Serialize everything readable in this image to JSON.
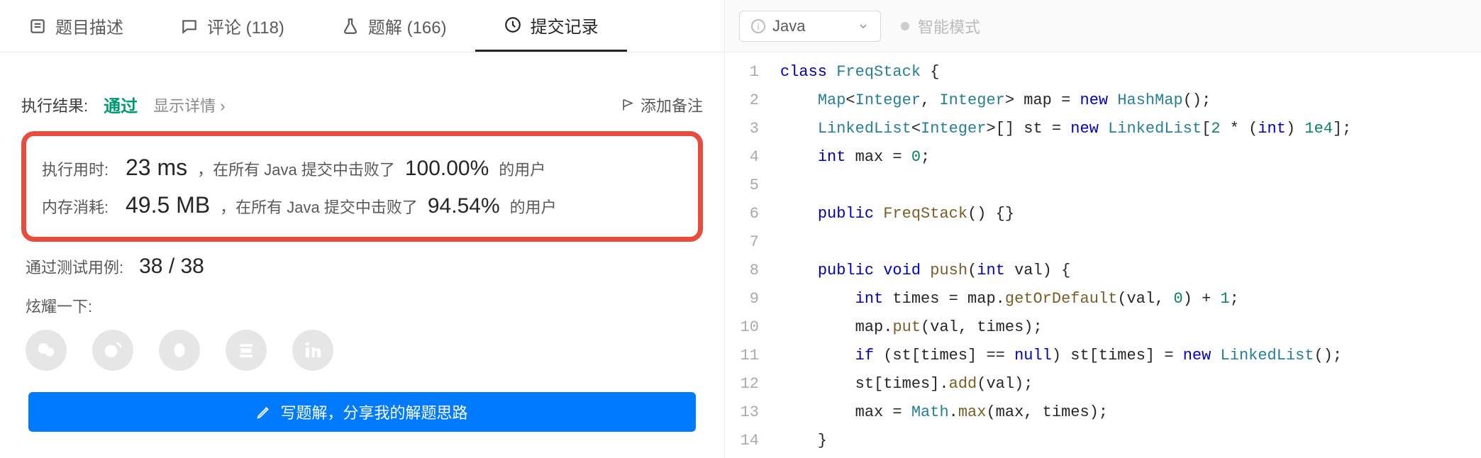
{
  "tabs": {
    "description": "题目描述",
    "comments": "评论 (118)",
    "solutions": "题解 (166)",
    "submissions": "提交记录"
  },
  "result": {
    "resultLabel": "执行结果:",
    "status": "通过",
    "detail": "显示详情 ›",
    "addNote": "添加备注",
    "runtime": {
      "label": "执行用时:",
      "value": "23 ms",
      "middle": "，在所有 Java 提交中击败了",
      "percent": "100.00%",
      "suffix": "的用户"
    },
    "memory": {
      "label": "内存消耗:",
      "value": "49.5 MB",
      "middle": "，在所有 Java 提交中击败了",
      "percent": "94.54%",
      "suffix": "的用户"
    },
    "cases": {
      "label": "通过测试用例:",
      "value": "38 / 38"
    },
    "share": {
      "label": "炫耀一下:"
    },
    "writeButton": "写题解，分享我的解题思路"
  },
  "editor": {
    "language": "Java",
    "smartMode": "智能模式",
    "code": [
      {
        "n": 1,
        "tokens": [
          [
            "kw",
            "class"
          ],
          [
            "",
            " "
          ],
          [
            "typ",
            "FreqStack"
          ],
          [
            "",
            " {"
          ]
        ]
      },
      {
        "n": 2,
        "tokens": [
          [
            "",
            "    "
          ],
          [
            "typ",
            "Map"
          ],
          [
            "",
            "<"
          ],
          [
            "typ",
            "Integer"
          ],
          [
            "",
            ", "
          ],
          [
            "typ",
            "Integer"
          ],
          [
            "",
            "> "
          ],
          [
            "",
            "map = "
          ],
          [
            "kw",
            "new"
          ],
          [
            "",
            " "
          ],
          [
            "typ",
            "HashMap"
          ],
          [
            "",
            "();"
          ]
        ]
      },
      {
        "n": 3,
        "tokens": [
          [
            "",
            "    "
          ],
          [
            "typ",
            "LinkedList"
          ],
          [
            "",
            "<"
          ],
          [
            "typ",
            "Integer"
          ],
          [
            "",
            ">[] st = "
          ],
          [
            "kw",
            "new"
          ],
          [
            "",
            " "
          ],
          [
            "typ",
            "LinkedList"
          ],
          [
            "",
            "["
          ],
          [
            "num",
            "2"
          ],
          [
            "",
            " * ("
          ],
          [
            "kw",
            "int"
          ],
          [
            "",
            ") "
          ],
          [
            "num",
            "1e4"
          ],
          [
            "",
            "];"
          ]
        ]
      },
      {
        "n": 4,
        "tokens": [
          [
            "",
            "    "
          ],
          [
            "kw",
            "int"
          ],
          [
            "",
            " max = "
          ],
          [
            "num",
            "0"
          ],
          [
            "",
            ";"
          ]
        ]
      },
      {
        "n": 5,
        "tokens": [
          [
            "",
            ""
          ]
        ]
      },
      {
        "n": 6,
        "tokens": [
          [
            "",
            "    "
          ],
          [
            "kw",
            "public"
          ],
          [
            "",
            " "
          ],
          [
            "mname",
            "FreqStack"
          ],
          [
            "",
            "() {}"
          ]
        ]
      },
      {
        "n": 7,
        "tokens": [
          [
            "",
            ""
          ]
        ]
      },
      {
        "n": 8,
        "tokens": [
          [
            "",
            "    "
          ],
          [
            "kw",
            "public"
          ],
          [
            "",
            " "
          ],
          [
            "kw",
            "void"
          ],
          [
            "",
            " "
          ],
          [
            "mname",
            "push"
          ],
          [
            "",
            "("
          ],
          [
            "kw",
            "int"
          ],
          [
            "",
            " val) {"
          ]
        ]
      },
      {
        "n": 9,
        "tokens": [
          [
            "",
            "        "
          ],
          [
            "kw",
            "int"
          ],
          [
            "",
            " times = map."
          ],
          [
            "mname",
            "getOrDefault"
          ],
          [
            "",
            "(val, "
          ],
          [
            "num",
            "0"
          ],
          [
            "",
            ") + "
          ],
          [
            "num",
            "1"
          ],
          [
            "",
            ";"
          ]
        ]
      },
      {
        "n": 10,
        "tokens": [
          [
            "",
            "        map."
          ],
          [
            "mname",
            "put"
          ],
          [
            "",
            "(val, times);"
          ]
        ]
      },
      {
        "n": 11,
        "tokens": [
          [
            "",
            "        "
          ],
          [
            "kw",
            "if"
          ],
          [
            "",
            " (st[times] == "
          ],
          [
            "kw",
            "null"
          ],
          [
            "",
            ") st[times] = "
          ],
          [
            "kw",
            "new"
          ],
          [
            "",
            " "
          ],
          [
            "typ",
            "LinkedList"
          ],
          [
            "",
            "();"
          ]
        ]
      },
      {
        "n": 12,
        "tokens": [
          [
            "",
            "        st[times]."
          ],
          [
            "mname",
            "add"
          ],
          [
            "",
            "(val);"
          ]
        ]
      },
      {
        "n": 13,
        "tokens": [
          [
            "",
            "        max = "
          ],
          [
            "typ",
            "Math"
          ],
          [
            "",
            "."
          ],
          [
            "mname",
            "max"
          ],
          [
            "",
            "(max, times);"
          ]
        ]
      },
      {
        "n": 14,
        "tokens": [
          [
            "",
            "    }"
          ]
        ]
      }
    ]
  }
}
